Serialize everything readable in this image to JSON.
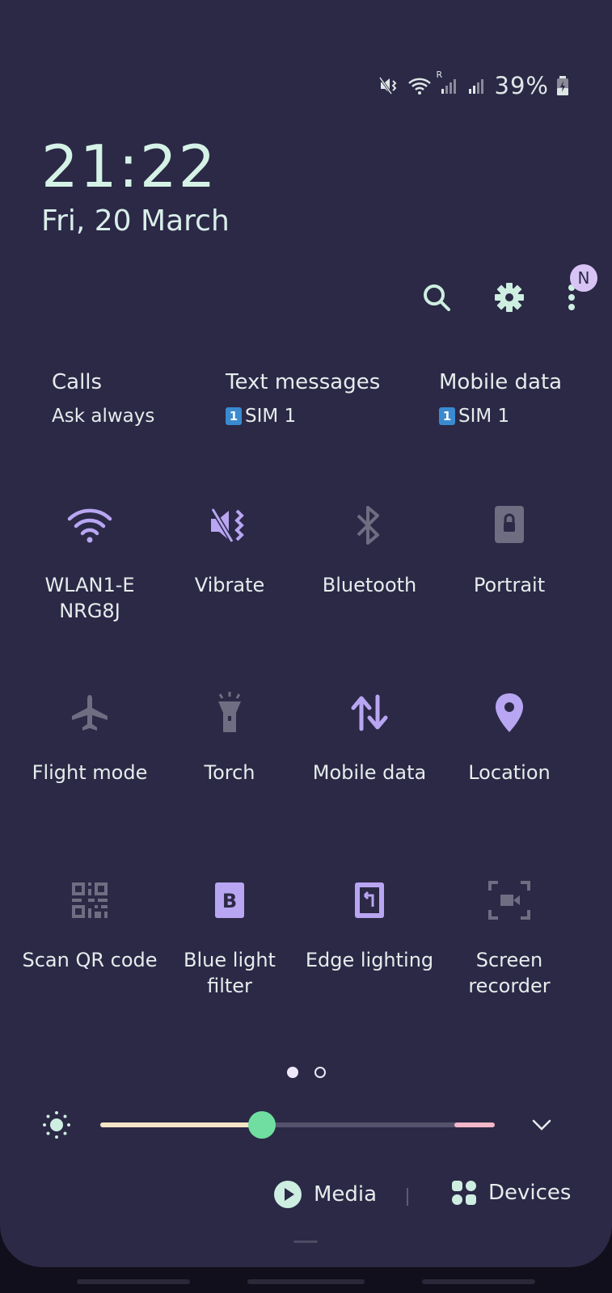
{
  "status_bar": {
    "battery": "39%",
    "icons": [
      "mute-vibrate-icon",
      "wifi-icon",
      "signal-roaming-icon",
      "signal-icon",
      "battery-charging-icon"
    ],
    "roaming_mark": "R"
  },
  "clock": {
    "time": "21:22",
    "date": "Fri, 20 March"
  },
  "top_actions": {
    "search_icon": "search-icon",
    "settings_icon": "gear-icon",
    "menu_icon": "more-vertical-icon",
    "badge": "N"
  },
  "sim": {
    "calls": {
      "title": "Calls",
      "value": "Ask always"
    },
    "text": {
      "title": "Text messages",
      "sim_num": "1",
      "value": "SIM 1"
    },
    "data": {
      "title": "Mobile data",
      "sim_num": "1",
      "value": "SIM 1"
    }
  },
  "tiles": [
    {
      "label": "WLAN1-E NRG8J",
      "icon": "wifi-icon",
      "active": true
    },
    {
      "label": "Vibrate",
      "icon": "vibrate-icon",
      "active": true
    },
    {
      "label": "Bluetooth",
      "icon": "bluetooth-icon",
      "active": false
    },
    {
      "label": "Portrait",
      "icon": "portrait-lock-icon",
      "active": false
    },
    {
      "label": "Flight mode",
      "icon": "airplane-icon",
      "active": false
    },
    {
      "label": "Torch",
      "icon": "torch-icon",
      "active": false
    },
    {
      "label": "Mobile data",
      "icon": "mobile-data-icon",
      "active": true
    },
    {
      "label": "Location",
      "icon": "location-icon",
      "active": true
    },
    {
      "label": "Scan QR code",
      "icon": "qr-code-icon",
      "active": false
    },
    {
      "label": "Blue light filter",
      "icon": "blue-light-icon",
      "active": true
    },
    {
      "label": "Edge lighting",
      "icon": "edge-lighting-icon",
      "active": true
    },
    {
      "label": "Screen recorder",
      "icon": "screen-recorder-icon",
      "active": false
    }
  ],
  "pagination": {
    "current": 1,
    "total": 2
  },
  "brightness": {
    "level": 0.41
  },
  "bottom": {
    "media": "Media",
    "devices": "Devices"
  },
  "colors": {
    "active_icon": "#b8a6f2",
    "inactive_icon": "#6f6d82",
    "panel": "#2b2946"
  }
}
